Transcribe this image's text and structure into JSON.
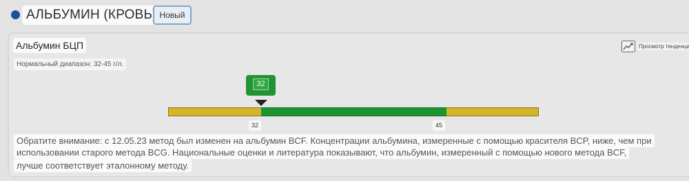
{
  "header": {
    "title": "АЛЬБУМИН (КРОВЬ)",
    "badge": "Новый",
    "dot_color": "#1f4f9c"
  },
  "result": {
    "test_name": "Альбумин БЦП",
    "trend_icon": "trend-chart-icon",
    "trend_label": "Просмотр тенденций",
    "normal_range_label": "Нормальный диапазон: 32-45 г/л.",
    "value": 32,
    "value_label": "32",
    "range_low": 32,
    "range_high": 45,
    "range_low_label": "32",
    "range_high_label": "45",
    "colors": {
      "normal": "#1d9432",
      "out_of_range": "#d4b527",
      "marker": "#229333"
    }
  },
  "note": {
    "line1": "Обратите внимание: с 12.05.23 метод был изменен на альбумин BCF. Концентрации альбумина, измеренные с помощью красителя BCP, ниже, чем при",
    "line2": "использовании старого метода BCG. Национальные оценки и литература показывают, что альбумин, измеренный с помощью нового метода BCF,",
    "line3": "лучше соответствует эталонному методу."
  }
}
